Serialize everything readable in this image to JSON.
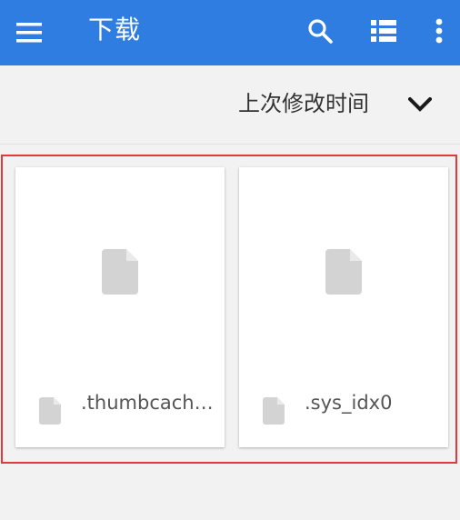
{
  "appbar": {
    "title": "下载",
    "color": "#2f7de1",
    "icons": [
      "menu-icon",
      "search-icon",
      "view-list-icon",
      "more-vert-icon"
    ]
  },
  "sort": {
    "label": "上次修改时间",
    "icon": "chevron-down-icon"
  },
  "files": [
    {
      "name": ".thumbcach…",
      "icon": "file-icon"
    },
    {
      "name": ".sys_idx0",
      "icon": "file-icon"
    }
  ],
  "highlight_color": "#e23a3a"
}
